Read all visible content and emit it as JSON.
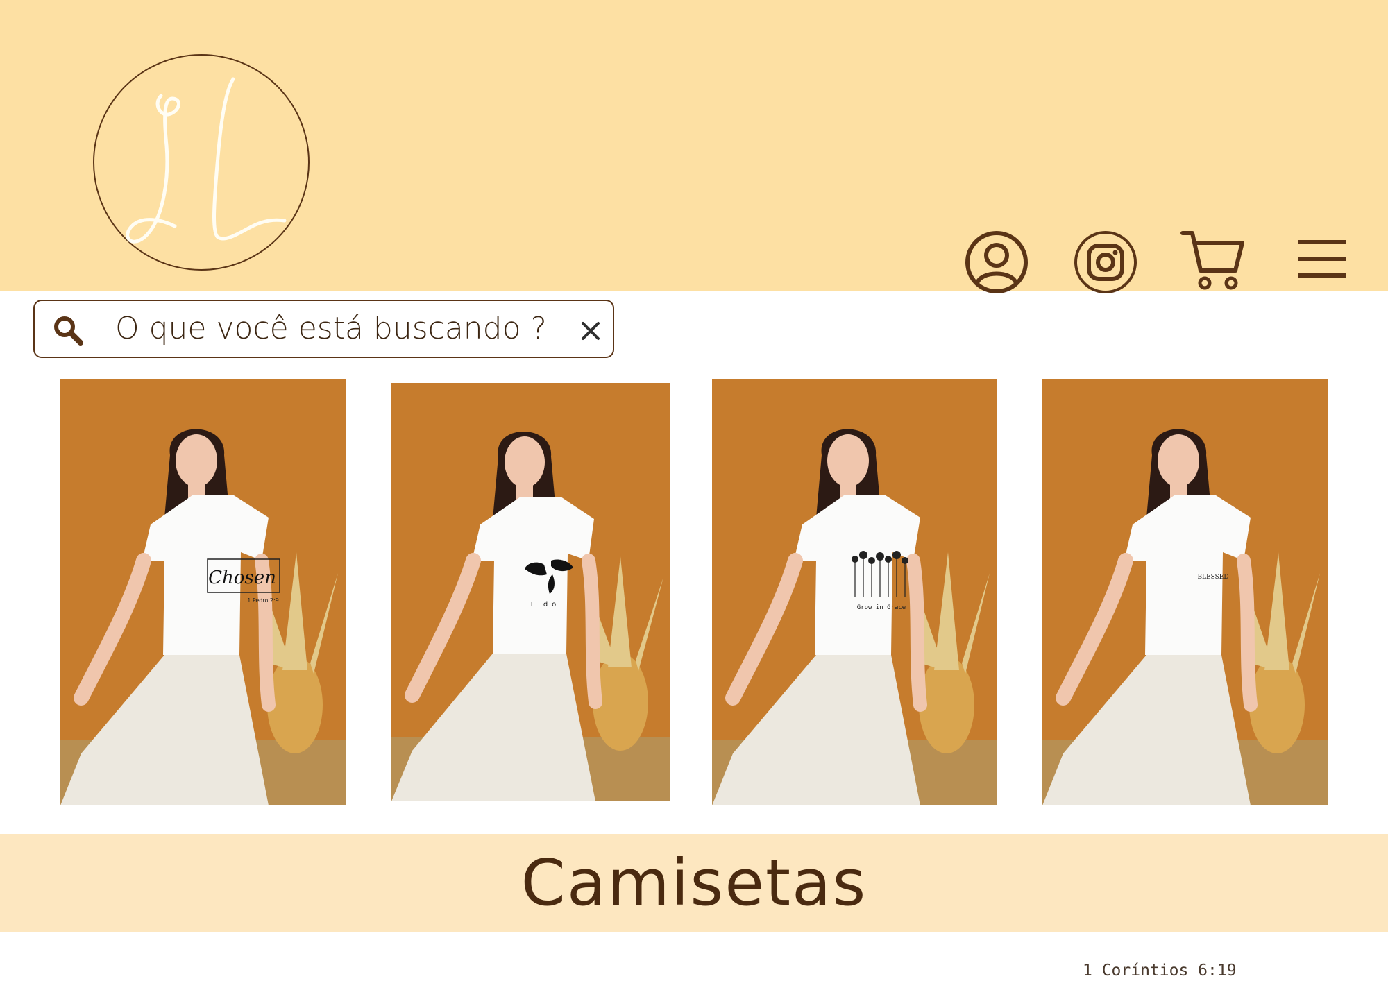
{
  "brand": {
    "monogram": "JL"
  },
  "search": {
    "placeholder": "O que você está buscando ?"
  },
  "nav_icons": [
    "user-icon",
    "instagram-icon",
    "cart-icon",
    "menu-icon"
  ],
  "products": [
    {
      "shirt_print": "Chosen",
      "shirt_subtext": "1 Pedro 2:9"
    },
    {
      "shirt_print": "I do"
    },
    {
      "shirt_print": "Grow in Grace"
    },
    {
      "shirt_print": "BLESSED"
    }
  ],
  "category": {
    "title": "Camisetas"
  },
  "footer": {
    "verse": "1 Coríntios 6:19"
  },
  "colors": {
    "header_bg": "#fde0a3",
    "band_bg": "#fde7c0",
    "brown": "#5a3416",
    "photo_wall": "#c67c2d"
  }
}
